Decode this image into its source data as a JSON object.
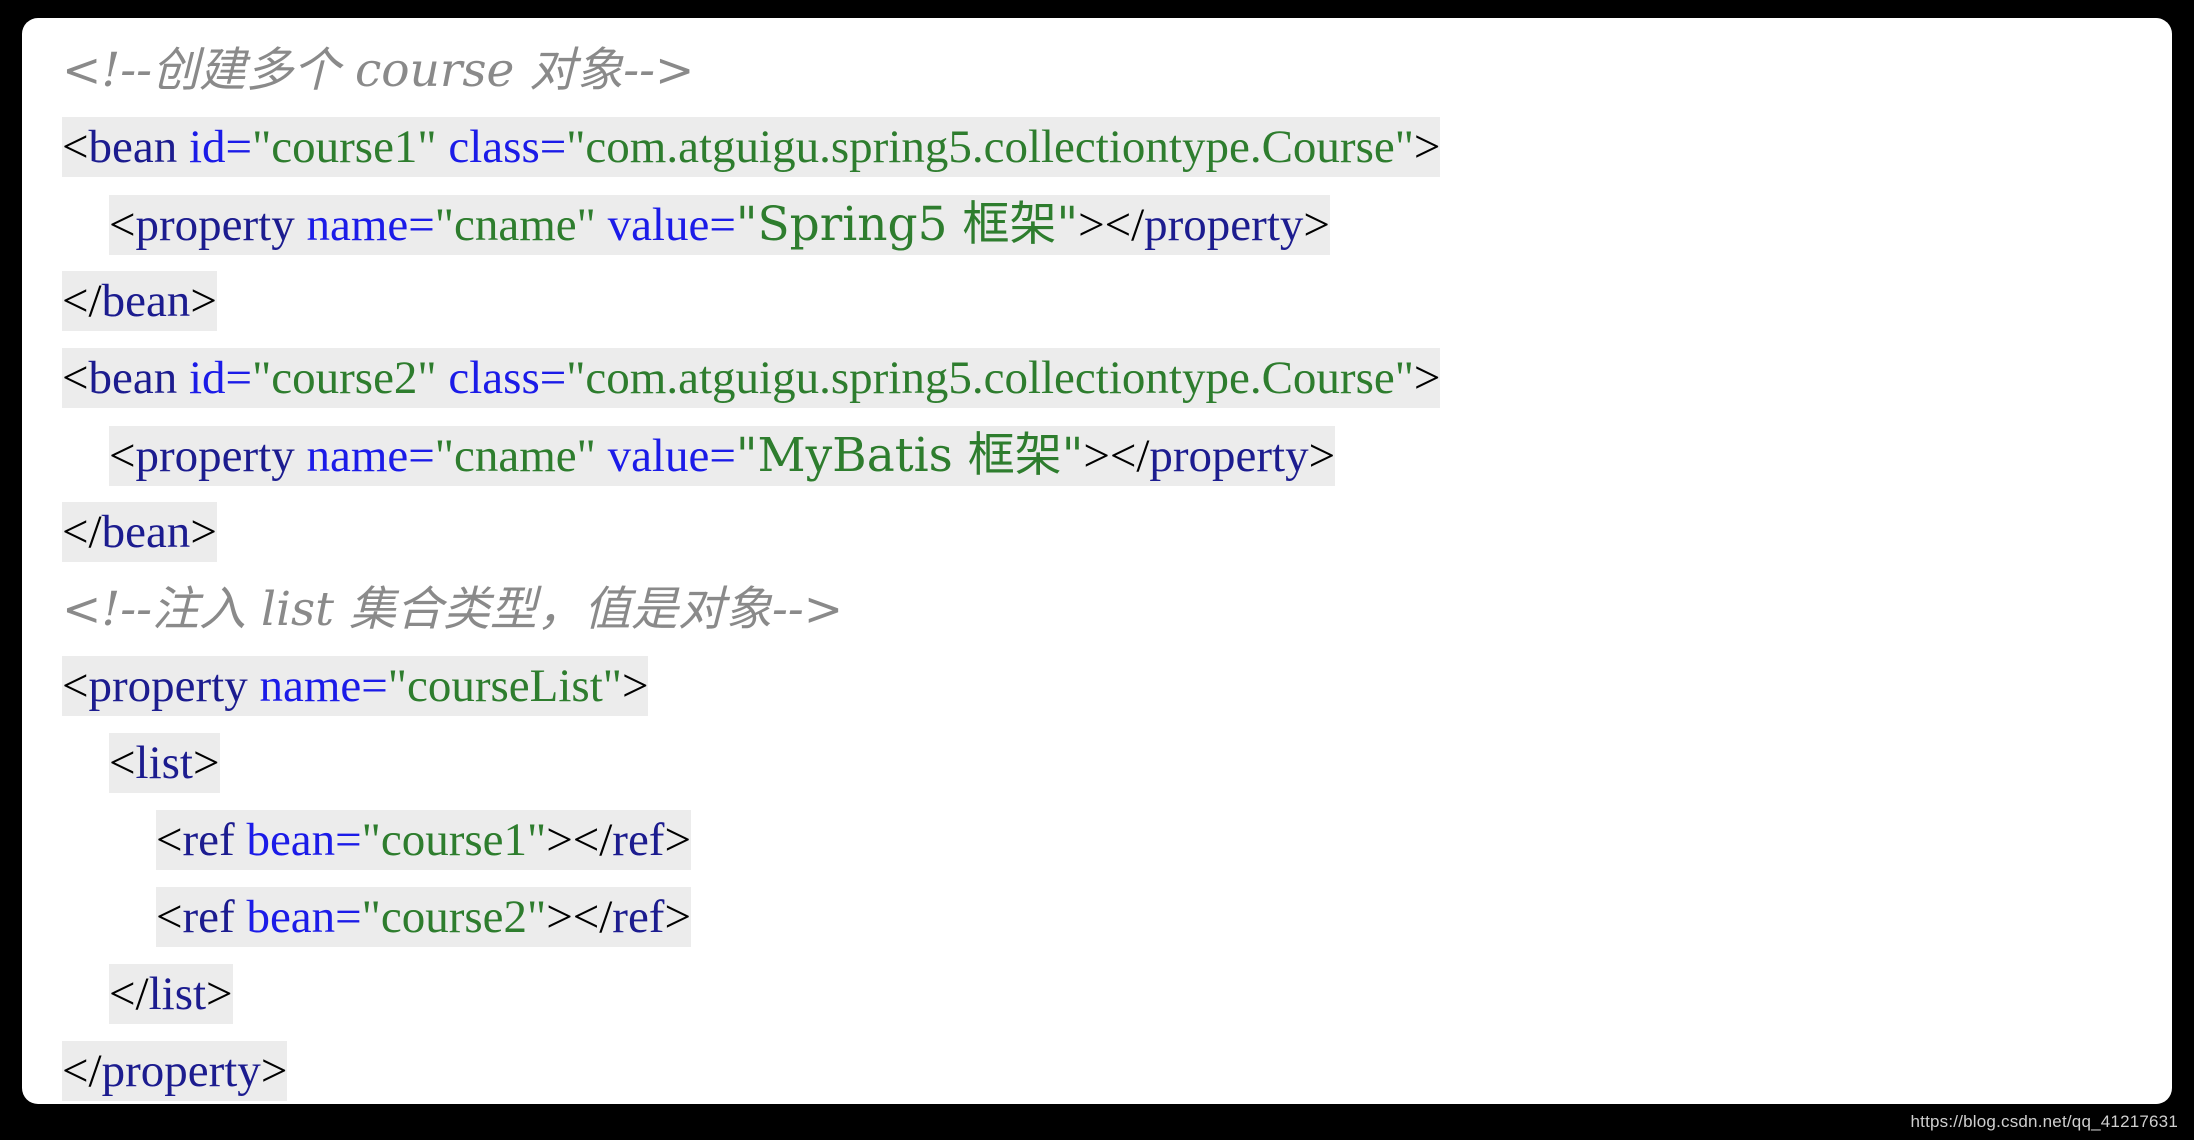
{
  "card": {
    "background_color": "#ffffff",
    "page_background_color": "#000000",
    "highlight_color": "#ececec"
  },
  "syntax_colors": {
    "punctuation": "#000000",
    "tag_name": "#1c1c8f",
    "attribute_name": "#1b1be8",
    "attribute_value": "#2e7d2e",
    "comment": "#8a8a8a"
  },
  "code": {
    "language": "xml",
    "lines": [
      {
        "id": "line-1",
        "type": "comment",
        "indent": "",
        "highlighted": false,
        "text": "<!--创建多个 course 对象-->",
        "tokens": [
          {
            "k": "comment",
            "t": "<!--创建多个 course 对象-->"
          }
        ]
      },
      {
        "id": "line-2",
        "type": "code",
        "indent": "",
        "highlighted": true,
        "text": "<bean id=\"course1\" class=\"com.atguigu.spring5.collectiontype.Course\">",
        "tokens": [
          {
            "k": "punc",
            "t": "<"
          },
          {
            "k": "tag",
            "t": "bean"
          },
          {
            "k": "punc",
            "t": " "
          },
          {
            "k": "attr",
            "t": "id="
          },
          {
            "k": "val",
            "t": "\"course1\""
          },
          {
            "k": "punc",
            "t": " "
          },
          {
            "k": "attr",
            "t": "class="
          },
          {
            "k": "val",
            "t": "\"com.atguigu.spring5.collectiontype.Course\""
          },
          {
            "k": "punc",
            "t": ">"
          }
        ]
      },
      {
        "id": "line-3",
        "type": "code",
        "indent": "    ",
        "highlighted": true,
        "text": "    <property name=\"cname\" value=\"Spring5 框架\"></property>",
        "tokens": [
          {
            "k": "punc",
            "t": "<"
          },
          {
            "k": "tag",
            "t": "property"
          },
          {
            "k": "punc",
            "t": " "
          },
          {
            "k": "attr",
            "t": "name="
          },
          {
            "k": "val",
            "t": "\"cname\""
          },
          {
            "k": "punc",
            "t": " "
          },
          {
            "k": "attr",
            "t": "value="
          },
          {
            "k": "val",
            "t": "\"Spring5 框架\""
          },
          {
            "k": "punc",
            "t": "></"
          },
          {
            "k": "tag",
            "t": "property"
          },
          {
            "k": "punc",
            "t": ">"
          }
        ]
      },
      {
        "id": "line-4",
        "type": "code",
        "indent": "",
        "highlighted": true,
        "text": "</bean>",
        "tokens": [
          {
            "k": "punc",
            "t": "</"
          },
          {
            "k": "tag",
            "t": "bean"
          },
          {
            "k": "punc",
            "t": ">"
          }
        ]
      },
      {
        "id": "line-5",
        "type": "code",
        "indent": "",
        "highlighted": true,
        "text": "<bean id=\"course2\" class=\"com.atguigu.spring5.collectiontype.Course\">",
        "tokens": [
          {
            "k": "punc",
            "t": "<"
          },
          {
            "k": "tag",
            "t": "bean"
          },
          {
            "k": "punc",
            "t": " "
          },
          {
            "k": "attr",
            "t": "id="
          },
          {
            "k": "val",
            "t": "\"course2\""
          },
          {
            "k": "punc",
            "t": " "
          },
          {
            "k": "attr",
            "t": "class="
          },
          {
            "k": "val",
            "t": "\"com.atguigu.spring5.collectiontype.Course\""
          },
          {
            "k": "punc",
            "t": ">"
          }
        ]
      },
      {
        "id": "line-6",
        "type": "code",
        "indent": "    ",
        "highlighted": true,
        "text": "    <property name=\"cname\" value=\"MyBatis 框架\"></property>",
        "tokens": [
          {
            "k": "punc",
            "t": "<"
          },
          {
            "k": "tag",
            "t": "property"
          },
          {
            "k": "punc",
            "t": " "
          },
          {
            "k": "attr",
            "t": "name="
          },
          {
            "k": "val",
            "t": "\"cname\""
          },
          {
            "k": "punc",
            "t": " "
          },
          {
            "k": "attr",
            "t": "value="
          },
          {
            "k": "val",
            "t": "\"MyBatis 框架\""
          },
          {
            "k": "punc",
            "t": "></"
          },
          {
            "k": "tag",
            "t": "property"
          },
          {
            "k": "punc",
            "t": ">"
          }
        ]
      },
      {
        "id": "line-7",
        "type": "code",
        "indent": "",
        "highlighted": true,
        "text": "</bean>",
        "tokens": [
          {
            "k": "punc",
            "t": "</"
          },
          {
            "k": "tag",
            "t": "bean"
          },
          {
            "k": "punc",
            "t": ">"
          }
        ]
      },
      {
        "id": "line-8",
        "type": "comment",
        "indent": "",
        "highlighted": false,
        "text": "<!--注入 list 集合类型，值是对象-->",
        "tokens": [
          {
            "k": "comment",
            "t": "<!--注入 list 集合类型，值是对象-->"
          }
        ]
      },
      {
        "id": "line-9",
        "type": "code",
        "indent": "",
        "highlighted": true,
        "text": "<property name=\"courseList\">",
        "tokens": [
          {
            "k": "punc",
            "t": "<"
          },
          {
            "k": "tag",
            "t": "property"
          },
          {
            "k": "punc",
            "t": " "
          },
          {
            "k": "attr",
            "t": "name="
          },
          {
            "k": "val",
            "t": "\"courseList\""
          },
          {
            "k": "punc",
            "t": ">"
          }
        ]
      },
      {
        "id": "line-10",
        "type": "code",
        "indent": "    ",
        "highlighted": true,
        "text": "    <list>",
        "tokens": [
          {
            "k": "punc",
            "t": "<"
          },
          {
            "k": "tag",
            "t": "list"
          },
          {
            "k": "punc",
            "t": ">"
          }
        ]
      },
      {
        "id": "line-11",
        "type": "code",
        "indent": "        ",
        "highlighted": true,
        "text": "        <ref bean=\"course1\"></ref>",
        "tokens": [
          {
            "k": "punc",
            "t": "<"
          },
          {
            "k": "tag",
            "t": "ref"
          },
          {
            "k": "punc",
            "t": " "
          },
          {
            "k": "attr",
            "t": "bean="
          },
          {
            "k": "val",
            "t": "\"course1\""
          },
          {
            "k": "punc",
            "t": "></"
          },
          {
            "k": "tag",
            "t": "ref"
          },
          {
            "k": "punc",
            "t": ">"
          }
        ]
      },
      {
        "id": "line-12",
        "type": "code",
        "indent": "        ",
        "highlighted": true,
        "text": "        <ref bean=\"course2\"></ref>",
        "tokens": [
          {
            "k": "punc",
            "t": "<"
          },
          {
            "k": "tag",
            "t": "ref"
          },
          {
            "k": "punc",
            "t": " "
          },
          {
            "k": "attr",
            "t": "bean="
          },
          {
            "k": "val",
            "t": "\"course2\""
          },
          {
            "k": "punc",
            "t": "></"
          },
          {
            "k": "tag",
            "t": "ref"
          },
          {
            "k": "punc",
            "t": ">"
          }
        ]
      },
      {
        "id": "line-13",
        "type": "code",
        "indent": "    ",
        "highlighted": true,
        "text": "    </list>",
        "tokens": [
          {
            "k": "punc",
            "t": "</"
          },
          {
            "k": "tag",
            "t": "list"
          },
          {
            "k": "punc",
            "t": ">"
          }
        ]
      },
      {
        "id": "line-14",
        "type": "code",
        "indent": "",
        "highlighted": true,
        "text": "</property>",
        "tokens": [
          {
            "k": "punc",
            "t": "</"
          },
          {
            "k": "tag",
            "t": "property"
          },
          {
            "k": "punc",
            "t": ">"
          }
        ]
      }
    ]
  },
  "watermark": {
    "text": "https://blog.csdn.net/qq_41217631"
  }
}
